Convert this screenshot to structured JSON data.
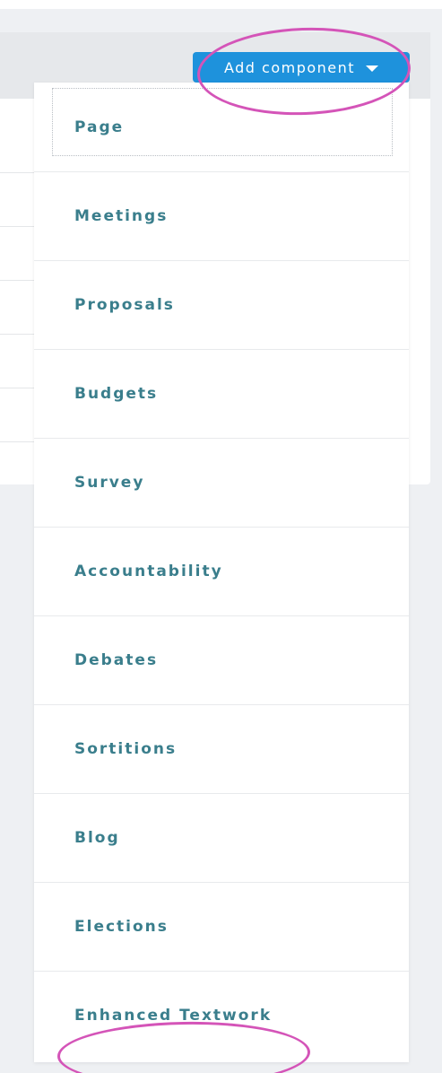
{
  "toolbar": {
    "add_component_label": "Add component",
    "dropdown_icon": "caret-down-icon"
  },
  "dropdown": {
    "items": [
      {
        "label": "Page"
      },
      {
        "label": "Meetings"
      },
      {
        "label": "Proposals"
      },
      {
        "label": "Budgets"
      },
      {
        "label": "Survey"
      },
      {
        "label": "Accountability"
      },
      {
        "label": "Debates"
      },
      {
        "label": "Sortitions"
      },
      {
        "label": "Blog"
      },
      {
        "label": "Elections"
      },
      {
        "label": "Enhanced Textwork"
      }
    ]
  },
  "colors": {
    "button": "#1e92dc",
    "item_text": "#3a7e8c",
    "highlight": "#d454b8",
    "background": "#eef0f3"
  }
}
